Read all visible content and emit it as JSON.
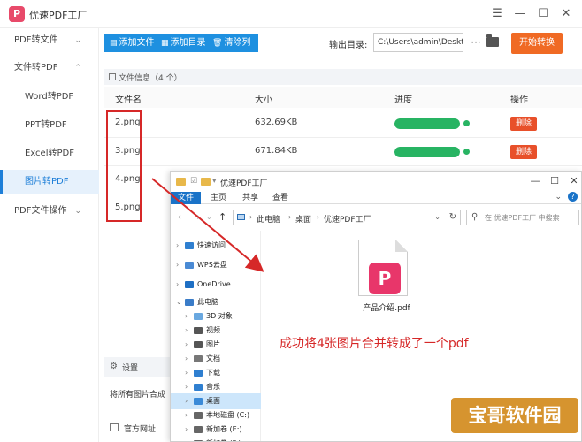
{
  "app": {
    "logo_letter": "P",
    "title": "优速PDF工厂",
    "controls": {
      "menu": "☰",
      "minimize": "—",
      "maximize": "☐",
      "close": "✕"
    }
  },
  "sidebar": {
    "items": [
      {
        "label": "PDF转文件",
        "chevron": "⌄"
      },
      {
        "label": "文件转PDF",
        "chevron": "⌃"
      },
      {
        "label": "Word转PDF"
      },
      {
        "label": "PPT转PDF"
      },
      {
        "label": "Excel转PDF"
      },
      {
        "label": "图片转PDF"
      },
      {
        "label": "PDF文件操作",
        "chevron": "⌄"
      }
    ]
  },
  "toolbar": {
    "add_file": "添加文件",
    "add_dir": "添加目录",
    "clear_list": "清除列表",
    "output_label": "输出目录:",
    "output_path": "C:\\Users\\admin\\Deskto",
    "more": "···",
    "start": "开始转换"
  },
  "file_info": {
    "label": "文件信息（4 个）"
  },
  "table": {
    "headers": {
      "name": "文件名",
      "size": "大小",
      "progress": "进度",
      "action": "操作"
    },
    "rows": [
      {
        "name": "2.png",
        "size": "632.69KB",
        "progress": 1.0,
        "action": "删除"
      },
      {
        "name": "3.png",
        "size": "671.84KB",
        "progress": 1.0,
        "action": "删除"
      },
      {
        "name": "4.png"
      },
      {
        "name": "5.png"
      }
    ]
  },
  "settings": {
    "label": "设置",
    "description": "将所有图片合成",
    "official_site": "官方网址"
  },
  "explorer": {
    "title": "优速PDF工厂",
    "ribbon_tabs": [
      "文件",
      "主页",
      "共享",
      "查看"
    ],
    "help": "?",
    "breadcrumb": [
      "此电脑",
      "桌面",
      "优速PDF工厂"
    ],
    "search_placeholder": "在 优速PDF工厂 中搜索",
    "nav_items": [
      {
        "label": "快速访问",
        "icon": "star-icon",
        "color": "#2f7fd0"
      },
      {
        "label": "WPS云盘",
        "icon": "cloud-icon",
        "color": "#4a8ad4"
      },
      {
        "label": "OneDrive",
        "icon": "cloud-icon",
        "color": "#1e6fc4"
      },
      {
        "label": "此电脑",
        "icon": "computer-icon",
        "color": "#3a7cc8"
      },
      {
        "label": "3D 对象",
        "icon": "cube-icon",
        "color": "#6aa8e0"
      },
      {
        "label": "视频",
        "icon": "video-icon",
        "color": "#555555"
      },
      {
        "label": "图片",
        "icon": "picture-icon",
        "color": "#555555"
      },
      {
        "label": "文档",
        "icon": "document-icon",
        "color": "#777777"
      },
      {
        "label": "下载",
        "icon": "download-icon",
        "color": "#2f7fd0"
      },
      {
        "label": "音乐",
        "icon": "music-icon",
        "color": "#2f7fd0"
      },
      {
        "label": "桌面",
        "icon": "desktop-icon",
        "color": "#3a8ad8"
      },
      {
        "label": "本地磁盘 (C:)",
        "icon": "drive-icon",
        "color": "#666666"
      },
      {
        "label": "新加卷 (E:)",
        "icon": "drive-icon",
        "color": "#666666"
      },
      {
        "label": "新加卷 (F:)",
        "icon": "drive-icon",
        "color": "#666666"
      }
    ],
    "selected_nav": "桌面",
    "file": {
      "name": "产品介绍.pdf",
      "badge": "P"
    }
  },
  "annotation": "成功将4张图片合并转成了一个pdf",
  "watermark": "宝哥软件园",
  "colors": {
    "accent_blue": "#1e90e0",
    "start_orange": "#f06a24",
    "progress_green": "#28b463",
    "delete_red": "#e8502a",
    "annotation_red": "#d62828",
    "pdf_pink": "#e8366a"
  }
}
